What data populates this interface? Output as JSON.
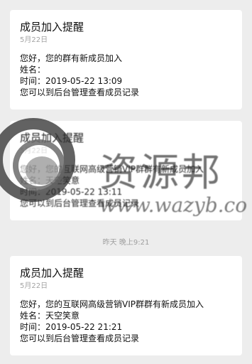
{
  "notifications": [
    {
      "title": "成员加入提醒",
      "date": "5月22日",
      "greeting": "您好，您的群有新成员加入",
      "name_line": "姓名：",
      "time_line": "时间：2019-05-22 13:09",
      "footer": "您可以到后台管理查看成员记录"
    },
    {
      "title": "成员加入提醒",
      "date": "5月22日",
      "greeting": "您好，您的互联网高级营销VIP群群有新成员加入",
      "name_line": "姓名：天空笑意",
      "time_line": "时间：2019-05-22 13:11",
      "footer": "您可以到后台管理查看成员记录"
    },
    {
      "title": "成员加入提醒",
      "date": "5月22日",
      "greeting": "您好，您的互联网高级营销VIP群群有新成员加入",
      "name_line": "姓名：天空笑意",
      "time_line": "时间：2019-05-22 21:21",
      "footer": "您可以到后台管理查看成员记录"
    }
  ],
  "time_divider": "昨天 晚上9:21",
  "watermark": {
    "logo_text": "资源邦",
    "url": "www.wazyb.co",
    "icon": "gear-logo-icon"
  },
  "colors": {
    "background": "#ededed",
    "card": "#ffffff",
    "muted_text": "#a3a3a3"
  }
}
